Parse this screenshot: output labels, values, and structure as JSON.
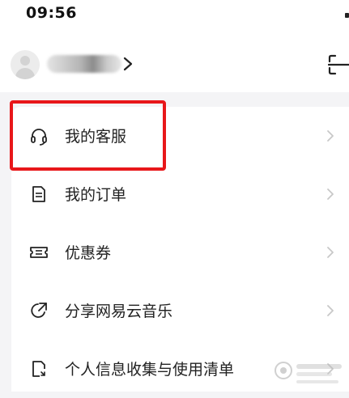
{
  "status_bar": {
    "time": "09:56"
  },
  "profile": {
    "username_blurred": true
  },
  "menu": {
    "items": [
      {
        "label": "我的客服",
        "icon": "headset-icon"
      },
      {
        "label": "我的订单",
        "icon": "document-icon"
      },
      {
        "label": "优惠券",
        "icon": "ticket-icon"
      },
      {
        "label": "分享网易云音乐",
        "icon": "share-icon"
      },
      {
        "label": "个人信息收集与使用清单",
        "icon": "info-doc-icon"
      }
    ]
  },
  "annotation": {
    "highlight_color": "#e8171a",
    "target": "我的客服"
  },
  "colors": {
    "background": "#f4f4f6",
    "card": "#ffffff",
    "chevron": "#c8c8c8"
  }
}
